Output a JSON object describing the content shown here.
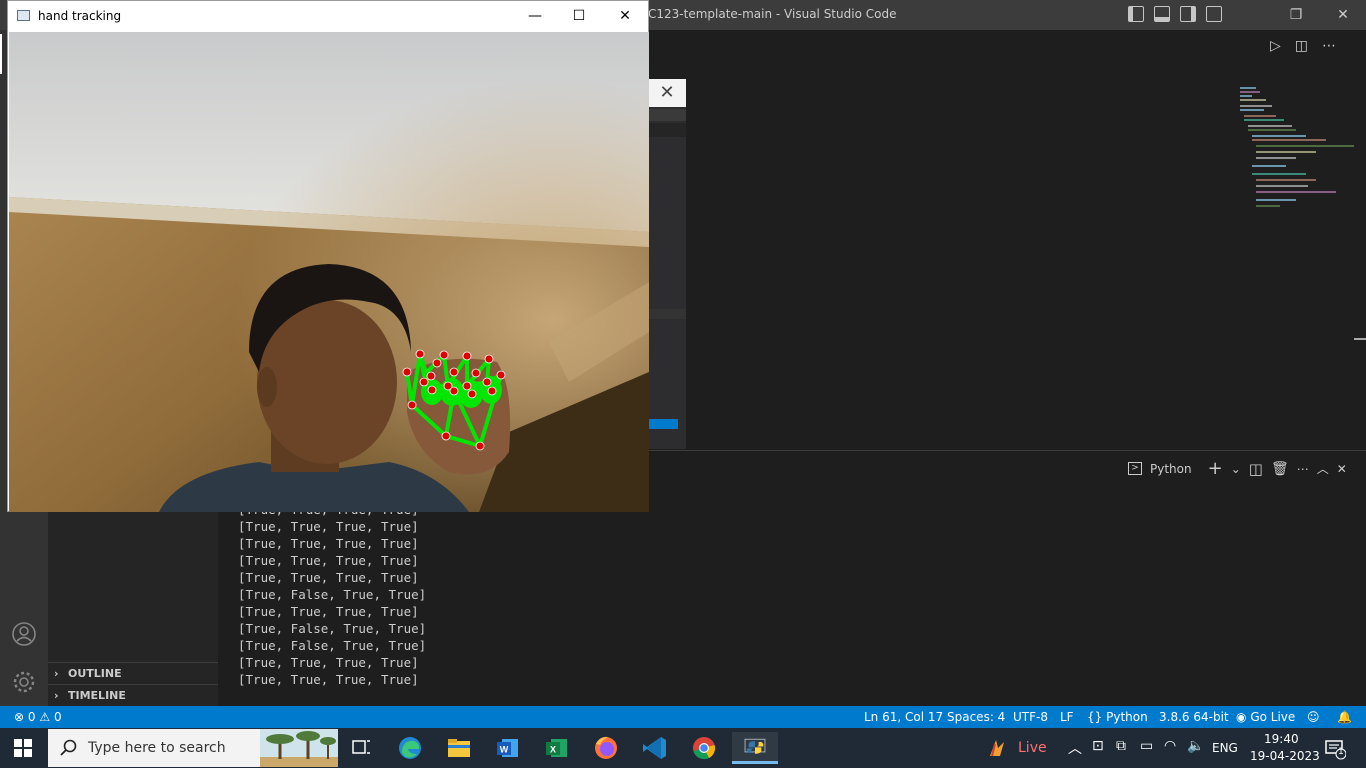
{
  "vscode": {
    "title": "C123-template-main - Visual Studio Code",
    "panel": {
      "terminal_label": "Python",
      "lines": [
        "[True, True, True, True]",
        "[True, True, True, True]",
        "[True, True, True, True]",
        "[True, True, True, True]",
        "[True, True, True, True]",
        "[True, False, True, True]",
        "[True, True, True, True]",
        "[True, False, True, True]",
        "[True, False, True, True]",
        "[True, True, True, True]",
        "[True, True, True, True]"
      ]
    },
    "sidebar": {
      "outline_label": "OUTLINE",
      "timeline_label": "TIMELINE"
    },
    "status": {
      "errors": "0",
      "warnings": "0",
      "position": "Ln 61, Col 17",
      "spaces": "Spaces: 4",
      "encoding": "UTF-8",
      "eol": "LF",
      "language": "Python",
      "interpreter": "3.8.6 64-bit",
      "golive": "Go Live"
    }
  },
  "hand_window": {
    "title": "hand tracking"
  },
  "taskbar": {
    "search_placeholder": "Type here to search",
    "live_label": "Live",
    "lang": "ENG",
    "time": "19:40",
    "date": "19-04-2023",
    "notification_count": "1"
  },
  "colors": {
    "vscode_status": "#007acc",
    "landmark_line": "#00e600",
    "landmark_point": "#e00000"
  }
}
